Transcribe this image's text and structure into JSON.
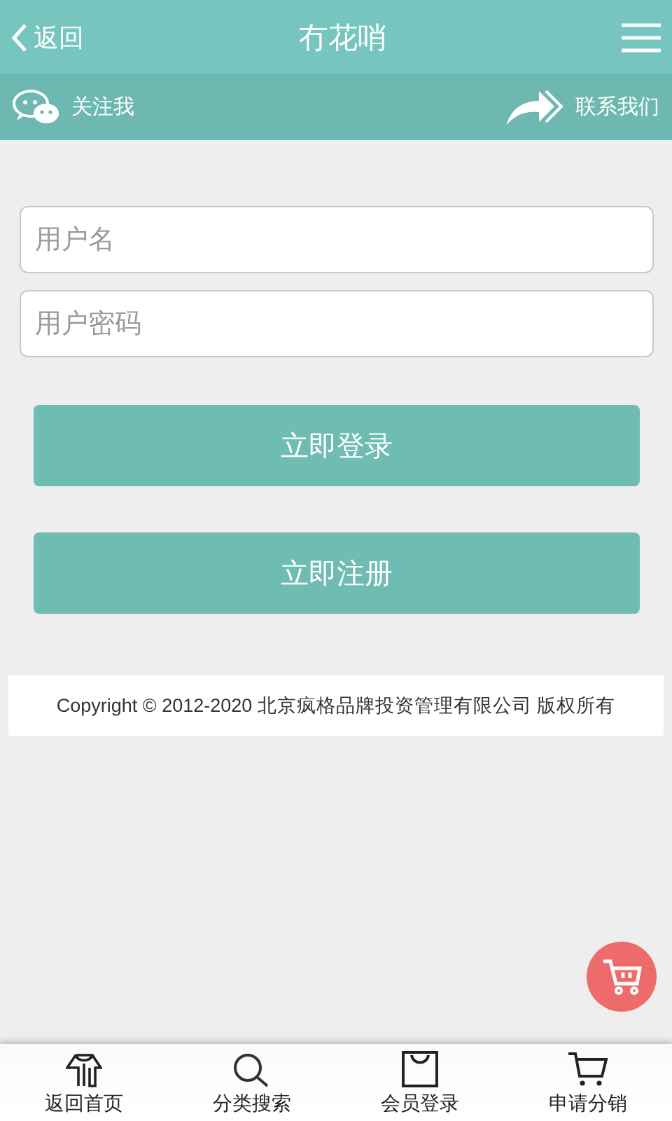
{
  "header": {
    "back": "返回",
    "title": "冇花哨"
  },
  "subbar": {
    "follow": "关注我",
    "contact": "联系我们"
  },
  "form": {
    "fields": [
      {
        "placeholder": "用户名"
      },
      {
        "placeholder": "用户密码"
      }
    ],
    "buttons": [
      "立即登录",
      "立即注册"
    ]
  },
  "copyright": "Copyright © 2012-2020 北京疯格品牌投资管理有限公司 版权所有",
  "tabbar": [
    {
      "kind": "shirt",
      "label": "返回首页"
    },
    {
      "kind": "search",
      "label": "分类搜索"
    },
    {
      "kind": "bag",
      "label": "会员登录"
    },
    {
      "kind": "cart",
      "label": "申请分销"
    }
  ]
}
